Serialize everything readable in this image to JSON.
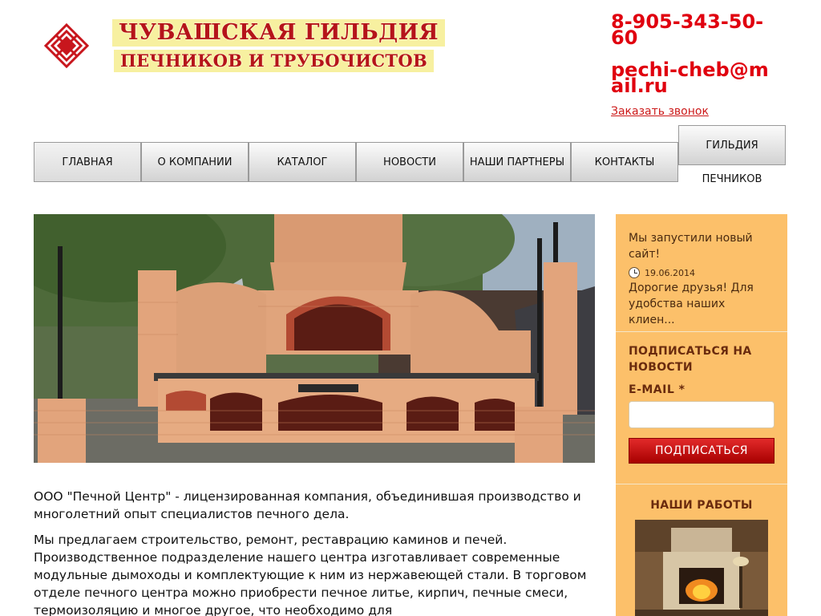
{
  "header": {
    "logo_line1": "ЧУВАШСКАЯ ГИЛЬДИЯ",
    "logo_line2": "ПЕЧНИКОВ И ТРУБОЧИСТОВ",
    "phone": "8-905-343-50-60",
    "email": "pechi-cheb@mail.ru",
    "callback": "Заказать звонок"
  },
  "nav": {
    "items": [
      "ГЛАВНАЯ",
      "О КОМПАНИИ",
      "КАТАЛОГ",
      "НОВОСТИ",
      "НАШИ ПАРТНЕРЫ",
      "КОНТАКТЫ",
      "ГИЛЬДИЯ"
    ],
    "sub_label": "ПЕЧНИКОВ"
  },
  "content": {
    "p1": "ООО \"Печной Центр\" - лицензированная компания, объединившая производство и многолетний опыт специалистов печного дела.",
    "p2": "Мы предлагаем строительство, ремонт, реставрацию каминов и печей. Производственное подразделение нашего центра изготавливает современные модульные дымоходы и комплектующие к ним из нержавеющей стали. В торговом отделе печного центра можно приобрести печное литье, кирпич, печные смеси, термоизоляцию и многое другое, что необходимо для"
  },
  "sidebar": {
    "news_title": "Мы запустили новый сайт!",
    "news_date": "19.06.2014",
    "news_text": "Дорогие друзья! Для удобства наших клиен...",
    "subscribe_title": "ПОДПИСАТЬСЯ НА НОВОСТИ",
    "email_label": "E-MAIL *",
    "subscribe_button": "ПОДПИСАТЬСЯ",
    "works_title": "НАШИ РАБОТЫ"
  },
  "colors": {
    "accent_red": "#e0000f",
    "sidebar_bg": "#fcc06a",
    "sidebar_text": "#6a2b0e"
  }
}
